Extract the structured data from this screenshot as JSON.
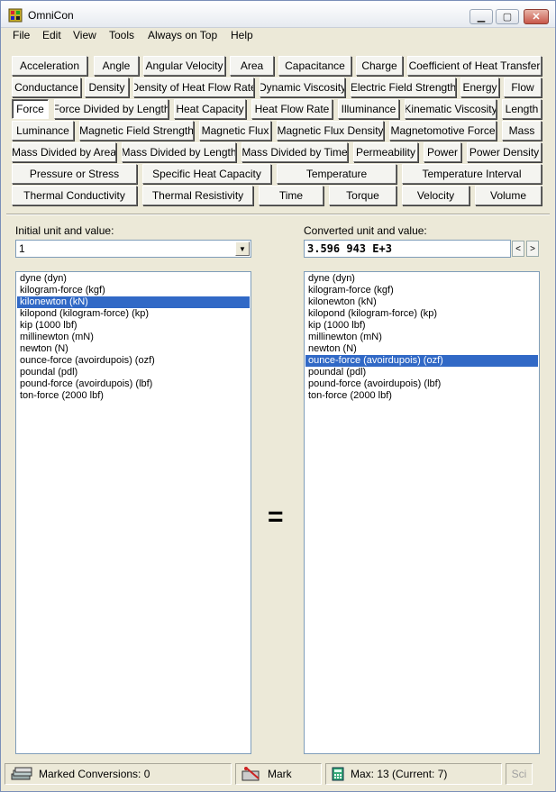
{
  "window": {
    "title": "OmniCon"
  },
  "menu": [
    "File",
    "Edit",
    "View",
    "Tools",
    "Always on Top",
    "Help"
  ],
  "categories": [
    [
      "Acceleration",
      "Angle",
      "Angular Velocity",
      "Area",
      "Capacitance",
      "Charge",
      "Coefficient of Heat Transfer"
    ],
    [
      "Conductance",
      "Density",
      "Density of Heat Flow Rate",
      "Dynamic Viscosity",
      "Electric Field Strength",
      "Energy",
      "Flow"
    ],
    [
      "Force",
      "Force Divided by Length",
      "Heat Capacity",
      "Heat Flow Rate",
      "Illuminance",
      "Kinematic Viscosity",
      "Length"
    ],
    [
      "Luminance",
      "Magnetic Field Strength",
      "Magnetic Flux",
      "Magnetic Flux Density",
      "Magnetomotive Force",
      "Mass"
    ],
    [
      "Mass Divided by Area",
      "Mass Divided by Length",
      "Mass Divided by Time",
      "Permeability",
      "Power",
      "Power Density"
    ],
    [
      "Pressure or Stress",
      "Specific Heat Capacity",
      "Temperature",
      "Temperature Interval"
    ],
    [
      "Thermal Conductivity",
      "Thermal Resistivity",
      "Time",
      "Torque",
      "Velocity",
      "Volume"
    ]
  ],
  "selected_category": "Force",
  "initial": {
    "label": "Initial unit and value:",
    "value": "1",
    "units": [
      "dyne (dyn)",
      "kilogram-force (kgf)",
      "kilonewton (kN)",
      "kilopond (kilogram-force) (kp)",
      "kip (1000 lbf)",
      "millinewton (mN)",
      "newton (N)",
      "ounce-force (avoirdupois) (ozf)",
      "poundal (pdl)",
      "pound-force (avoirdupois) (lbf)",
      "ton-force (2000 lbf)"
    ],
    "selected_index": 2
  },
  "converted": {
    "label": "Converted unit and value:",
    "value": "3.596 943 E+3",
    "units": [
      "dyne (dyn)",
      "kilogram-force (kgf)",
      "kilonewton (kN)",
      "kilopond (kilogram-force) (kp)",
      "kip (1000 lbf)",
      "millinewton (mN)",
      "newton (N)",
      "ounce-force (avoirdupois) (ozf)",
      "poundal (pdl)",
      "pound-force (avoirdupois) (lbf)",
      "ton-force (2000 lbf)"
    ],
    "selected_index": 7,
    "spin_left": "<",
    "spin_right": ">"
  },
  "equals_sign": "=",
  "status": {
    "marked": "Marked Conversions: 0",
    "mark_label": "Mark",
    "precision": "Max: 13 (Current: 7)",
    "sci": "Sci"
  }
}
